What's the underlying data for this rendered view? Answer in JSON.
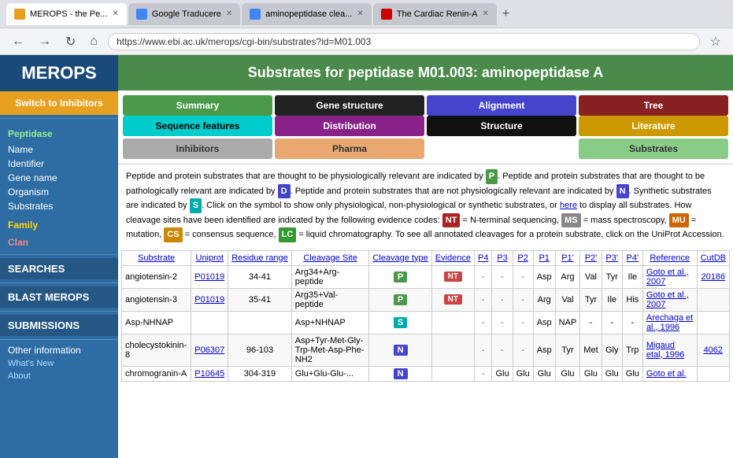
{
  "browser": {
    "tabs": [
      {
        "label": "MEROPS - the Pe...",
        "favicon_color": "#666",
        "active": true
      },
      {
        "label": "Google Traducere",
        "favicon_color": "#4285f4",
        "active": false
      },
      {
        "label": "aminopeptidase clea...",
        "favicon_color": "#4285f4",
        "active": false
      },
      {
        "label": "The Cardiac Renin-A",
        "favicon_color": "#cc0000",
        "active": false
      }
    ],
    "url": "https://www.ebi.ac.uk/merops/cgi-bin/substrates?id=M01.003"
  },
  "sidebar": {
    "logo": "MEROPS",
    "switch_label": "Switch to Inhibitors",
    "peptidase_label": "Peptidase",
    "peptidase_items": [
      "Name",
      "Identifier",
      "Gene name",
      "Organism",
      "Substrates"
    ],
    "family_label": "Family",
    "clan_label": "Clan",
    "searches_label": "SEARCHES",
    "blast_label": "BLAST MEROPS",
    "submissions_label": "SUBMISSIONS",
    "other_label": "Other information",
    "whats_new": "What's New",
    "about": "About"
  },
  "main": {
    "page_title": "Substrates for peptidase M01.003: aminopeptidase A",
    "tabs": {
      "row1": [
        {
          "label": "Summary",
          "style": "green"
        },
        {
          "label": "Gene structure",
          "style": "dark"
        },
        {
          "label": "Alignment",
          "style": "blue"
        },
        {
          "label": "Tree",
          "style": "darkred"
        }
      ],
      "row2": [
        {
          "label": "Sequence features",
          "style": "cyan"
        },
        {
          "label": "Distribution",
          "style": "purple"
        },
        {
          "label": "Structure",
          "style": "black"
        },
        {
          "label": "Literature",
          "style": "gold"
        }
      ],
      "row3": [
        {
          "label": "Inhibitors",
          "style": "gray"
        },
        {
          "label": "Pharma",
          "style": "peach"
        },
        {
          "label": "",
          "style": ""
        },
        {
          "label": "Substrates",
          "style": "lightgreen"
        }
      ]
    },
    "desc": "Peptide and protein substrates that are thought to be physiologically relevant are indicated by P. Peptide and protein substrates that are thought to be pathologically relevant are indicated by D. Peptide and protein substrates that are not physiologically relevant are indicated by N. Synthetic substrates are indicated by S. Click on the symbol to show only physiological, non-physiological or synthetic substrates, or here to display all substrates. How cleavage sites have been identified are indicated by the following evidence codes: NT = N-terminal sequencing, MS = mass spectroscopy, MU = mutation, CS = consensus sequence, LC = liquid chromatography. To see all annotated cleavages for a protein substrate, click on the UniProt Accession.",
    "table": {
      "headers": [
        "Substrate",
        "Uniprot",
        "Residue range",
        "Cleavage Site",
        "Cleavage type",
        "Evidence",
        "P4",
        "P3",
        "P2",
        "P1",
        "P1'",
        "P2'",
        "P3'",
        "P4'",
        "Reference",
        "CutDB"
      ],
      "rows": [
        {
          "substrate": "angiotensin-2",
          "uniprot": "P01019",
          "residue": "34-41",
          "cleavage_site": "Arg34+Arg-peptide",
          "cleavage_type": "P",
          "evidence": "NT",
          "p4": "-",
          "p3": "-",
          "p2": "-",
          "p1": "Asp",
          "p1p": "Arg",
          "p2p": "Val",
          "p3p": "Tyr",
          "p4p": "Ile",
          "reference": "Goto et al., 2007",
          "cutdb": "20186"
        },
        {
          "substrate": "angiotensin-3",
          "uniprot": "P01019",
          "residue": "35-41",
          "cleavage_site": "Arg35+Val-peptide",
          "cleavage_type": "P",
          "evidence": "NT",
          "p4": "-",
          "p3": "-",
          "p2": "-",
          "p1": "Arg",
          "p1p": "Val",
          "p2p": "Tyr",
          "p3p": "Ile",
          "p4p": "His",
          "reference": "Goto et al., 2007",
          "cutdb": ""
        },
        {
          "substrate": "Asp-NHNAP",
          "uniprot": "",
          "residue": "",
          "cleavage_site": "Asp+NHNAP",
          "cleavage_type": "S",
          "evidence": "",
          "p4": "-",
          "p3": "-",
          "p2": "-",
          "p1": "Asp",
          "p1p": "NAP",
          "p2p": "-",
          "p3p": "-",
          "p4p": "-",
          "reference": "Arechaga et al., 1996",
          "cutdb": ""
        },
        {
          "substrate": "cholecystokinin-8",
          "uniprot": "P06307",
          "residue": "96-103",
          "cleavage_site": "Asp+Tyr-Met-Gly-Trp-Met-Asp-Phe-NH2",
          "cleavage_type": "N",
          "evidence": "",
          "p4": "-",
          "p3": "-",
          "p2": "-",
          "p1": "Asp",
          "p1p": "Tyr",
          "p2p": "Met",
          "p3p": "Gly",
          "p4p": "Trp",
          "reference": "Migaud etal, 1996",
          "cutdb": "4062"
        },
        {
          "substrate": "chromogranin-A",
          "uniprot": "P10645",
          "residue": "304-319",
          "cleavage_site": "Glu+Glu-Glu-...",
          "cleavage_type": "N",
          "evidence": "",
          "p4": "-",
          "p3": "Glu",
          "p2": "Glu",
          "p1": "Glu",
          "p1p": "Glu",
          "p2p": "Glu",
          "p3p": "Glu",
          "p4p": "Glu",
          "reference": "Goto et al.",
          "cutdb": ""
        }
      ]
    }
  }
}
